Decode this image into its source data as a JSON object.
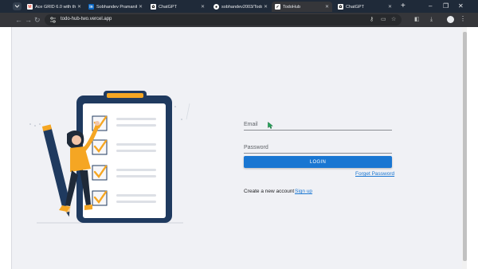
{
  "browser": {
    "tabs": [
      {
        "title": "Ace GRID 6.0 with the ...",
        "favicon": "gmail-icon",
        "color": "#ea4335",
        "active": false
      },
      {
        "title": "Sobhandev Pramanik | ...",
        "favicon": "linkedin-icon",
        "color": "#0a66c2",
        "active": false
      },
      {
        "title": "ChatGPT",
        "favicon": "chatgpt-icon",
        "color": "#ffffff",
        "active": false
      },
      {
        "title": "sobhandev2003/TodoH...",
        "favicon": "github-icon",
        "color": "#ffffff",
        "active": false
      },
      {
        "title": "TodoHub",
        "favicon": "todohub-icon",
        "color": "#ffffff",
        "active": true
      },
      {
        "title": "ChatGPT",
        "favicon": "chatgpt-icon",
        "color": "#ffffff",
        "active": false
      }
    ],
    "url": "todo-hub-two.vercel.app"
  },
  "login": {
    "email_label": "Email",
    "password_label": "Password",
    "login_button": "LOGIN",
    "forgot_password": "Forget Password",
    "signup_prompt": "Create a new account",
    "signup_link": "Sign up"
  },
  "colors": {
    "primary": "#1976d2",
    "page_bg": "#f0f1f5",
    "clipboard": "#1f3a5f",
    "check_accent": "#f5a623"
  }
}
